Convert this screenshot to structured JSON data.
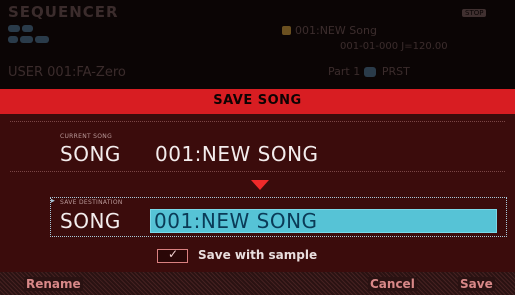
{
  "header": {
    "title": "SEQUENCER",
    "song_name": "001:NEW Song",
    "time": "001-01-000  J=120.00",
    "status": "STOP",
    "user_tone": "USER 001:FA-Zero",
    "part": "Part 1",
    "part_tag": "PRST"
  },
  "dialog": {
    "title": "SAVE SONG",
    "current_label": "CURRENT SONG",
    "current_prefix": "SONG",
    "current_value": "001:NEW SONG",
    "dest_label": "SAVE DESTINATION",
    "dest_prefix": "SONG",
    "dest_value": "001:NEW SONG",
    "save_with_sample_label": "Save with sample",
    "save_with_sample_checked": true
  },
  "footer": {
    "rename": "Rename",
    "cancel": "Cancel",
    "save": "Save"
  },
  "colors": {
    "title_bar": "#d81d22",
    "dialog_bg": "#3b0c0c",
    "dest_field": "#56c3d6",
    "arrow": "#ef2a2a"
  }
}
